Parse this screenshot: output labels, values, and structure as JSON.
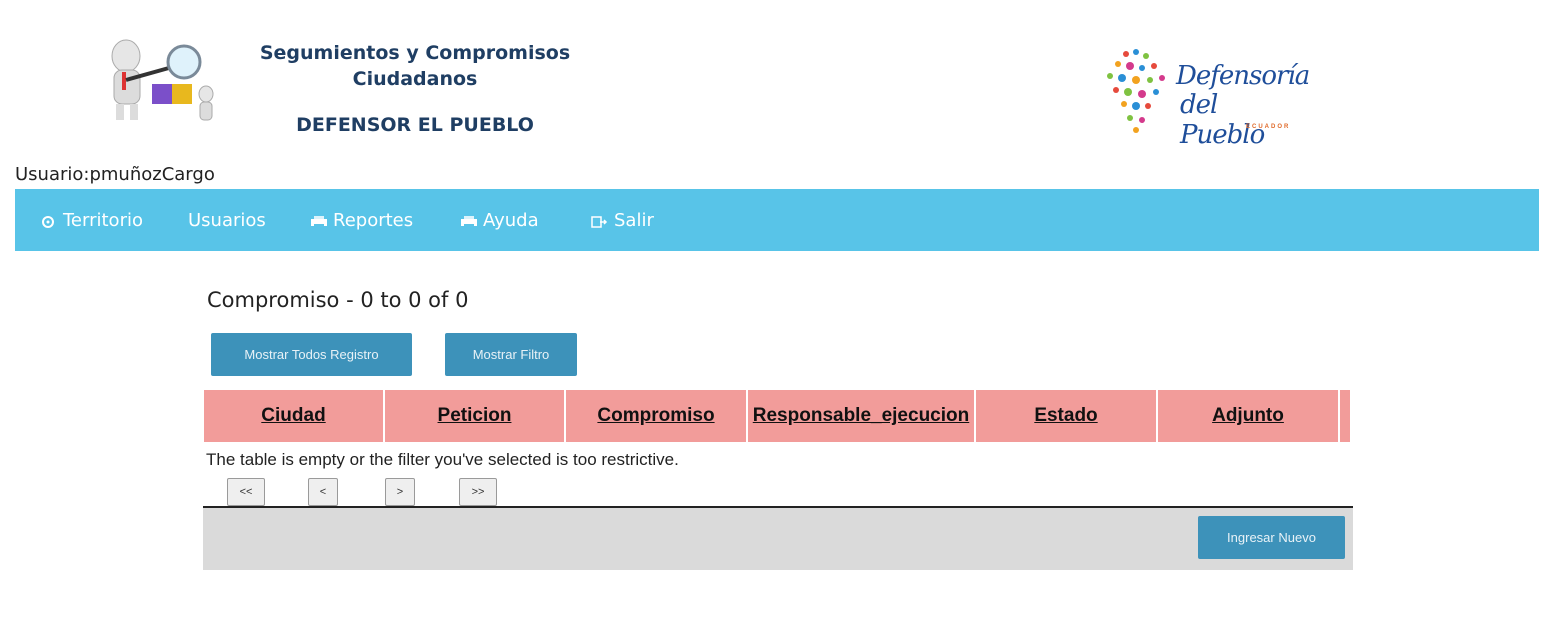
{
  "header": {
    "title_line1": "Segumientos y Compromisos",
    "title_line2": "Ciudadanos",
    "subtitle": "DEFENSOR EL PUEBLO",
    "logo_right_line1": "Defensoría",
    "logo_right_line2": "del Pueblo",
    "logo_right_country": "ECUADOR"
  },
  "usuario": "Usuario:pmuñozCargo",
  "nav": {
    "items": [
      {
        "label": "Territorio",
        "icon": "settings-icon"
      },
      {
        "label": "Usuarios",
        "icon": ""
      },
      {
        "label": "Reportes",
        "icon": "printer-icon"
      },
      {
        "label": "Ayuda",
        "icon": "printer-icon"
      },
      {
        "label": "Salir",
        "icon": "exit-icon"
      }
    ]
  },
  "main": {
    "title": "Compromiso - 0 to 0 of 0",
    "show_all_label": "Mostrar Todos Registro",
    "show_filter_label": "Mostrar Filtro",
    "columns": [
      "Ciudad",
      "Peticion",
      "Compromiso",
      "Responsable_ejecucion",
      "Estado",
      "Adjunto"
    ],
    "empty_message": "The table is empty or the filter you've selected is too restrictive.",
    "pager": {
      "first": "<<",
      "prev": "<",
      "next": ">",
      "last": ">>"
    },
    "new_label": "Ingresar Nuevo"
  },
  "colors": {
    "nav_bg": "#58c4e8",
    "button_bg": "#3d92ba",
    "table_header_bg": "#f29c9a",
    "footer_bg": "#dadada",
    "title_color": "#1f3e63"
  }
}
